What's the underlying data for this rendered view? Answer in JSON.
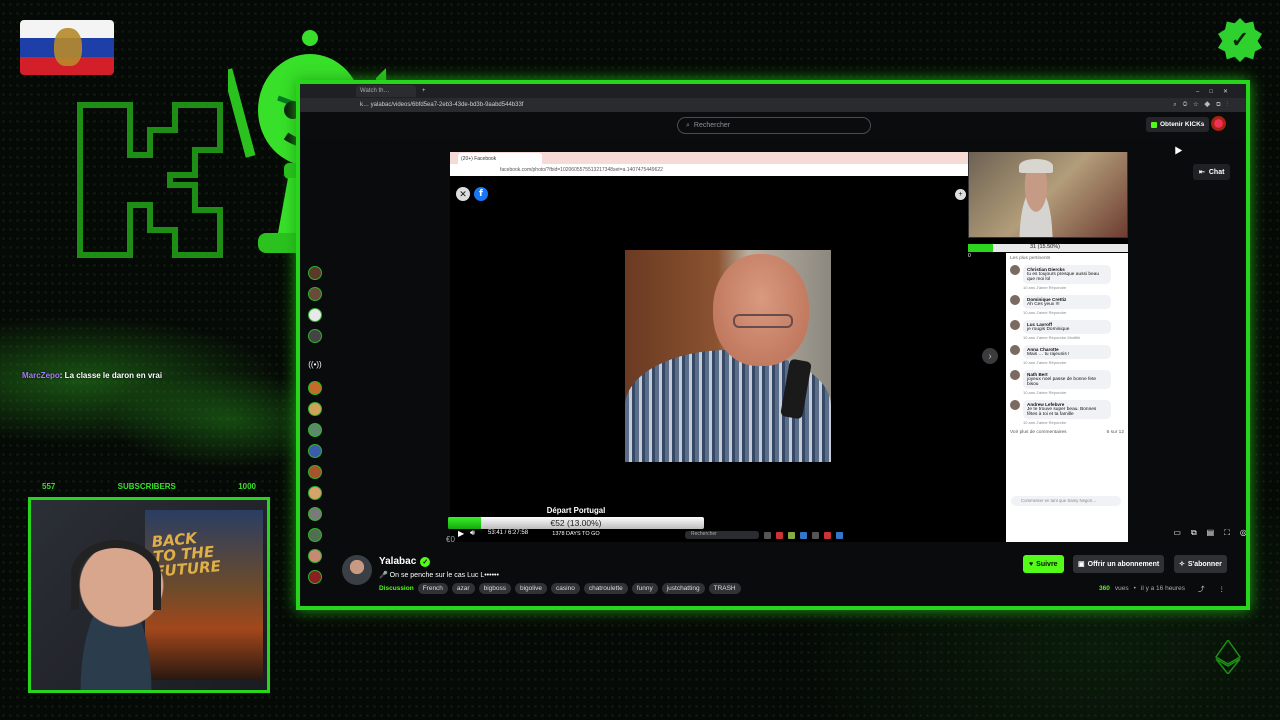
{
  "overlay": {
    "chat_message": {
      "user": "MarcZepo",
      "text": ": La classe le daron en vrai"
    },
    "subscribers_bar": {
      "current": "557",
      "label": "SUBSCRIBERS",
      "goal": "1000"
    }
  },
  "browser": {
    "tab_label": "Watch th…",
    "url": "k… yalabac/videos/6bfd5ea7-2eb3-43de-bd3b-9aabd544b33f",
    "search_placeholder": "Rechercher",
    "kicks_label": "Obtenir KICKs",
    "chat_label": "Chat"
  },
  "inner_screen": {
    "tab_label": "(20+) Facebook",
    "url": "facebook.com/photo/?fbid=1020605575513217348set=a.1407475449622",
    "comments_header": "Les plus pertinents",
    "comments": [
      {
        "author": "Christian Diercks",
        "text": "tu es toujours presque aussi beau que moi lol",
        "meta": "10 ans   J'aime   Répondre"
      },
      {
        "author": "Dominique Crettiz",
        "text": "Ah Ces yeux !!!",
        "meta": "10 ans   J'aime   Répondre"
      },
      {
        "author": "Luc Lavroff",
        "text": "je rougis Dominique",
        "meta": "10 ans   J'aime   Répondre   Modifié"
      },
      {
        "author": "Anna Charotte",
        "text": "Mais … tu rajeunis !",
        "meta": "10 ans   J'aime   Répondre"
      },
      {
        "author": "Nath Bert",
        "text": "joyeux noel passe de bonne fete bisou",
        "meta": "10 ans   J'aime   Répondre"
      },
      {
        "author": "Andrew Lefebvre",
        "text": "Je te trouve super beau. Bonnes fêtes à toi et ta famille",
        "meta": "10 ans   J'aime   Répondre"
      }
    ],
    "more_comments": "Voir plus de commentaires",
    "more_count": "6 sur 12",
    "comment_placeholder": "Commenter en tant que Samy Negon…",
    "mini_progress_label": "31 (15.50%)",
    "mini_progress_fraction": 0.155,
    "zero_label": "0"
  },
  "goal": {
    "title": "Départ Portugal",
    "amount_label": "€52 (13.00%)",
    "fraction": 0.13,
    "days": "1378 DAYS TO GO",
    "start": "€0"
  },
  "player": {
    "time": "53:41 / 6:27:58",
    "taskbar_search": "Rechercher"
  },
  "stream": {
    "streamer": "Yalabac",
    "title": "🎤 On se penche sur le cas Luc L••••••",
    "category": "Discussion",
    "tags": [
      "French",
      "azar",
      "bigboss",
      "bigolive",
      "casino",
      "chatroulette",
      "funny",
      "justchatting",
      "TRASH"
    ],
    "follow_label": "Suivre",
    "gift_label": "Offrir un abonnement",
    "subscribe_label": "S'abonner",
    "views_count": "360",
    "views_unit": "vues",
    "age": "il y a 16 heures"
  },
  "colors": {
    "kick_green": "#53fc18",
    "frame_green": "#27d51c"
  }
}
